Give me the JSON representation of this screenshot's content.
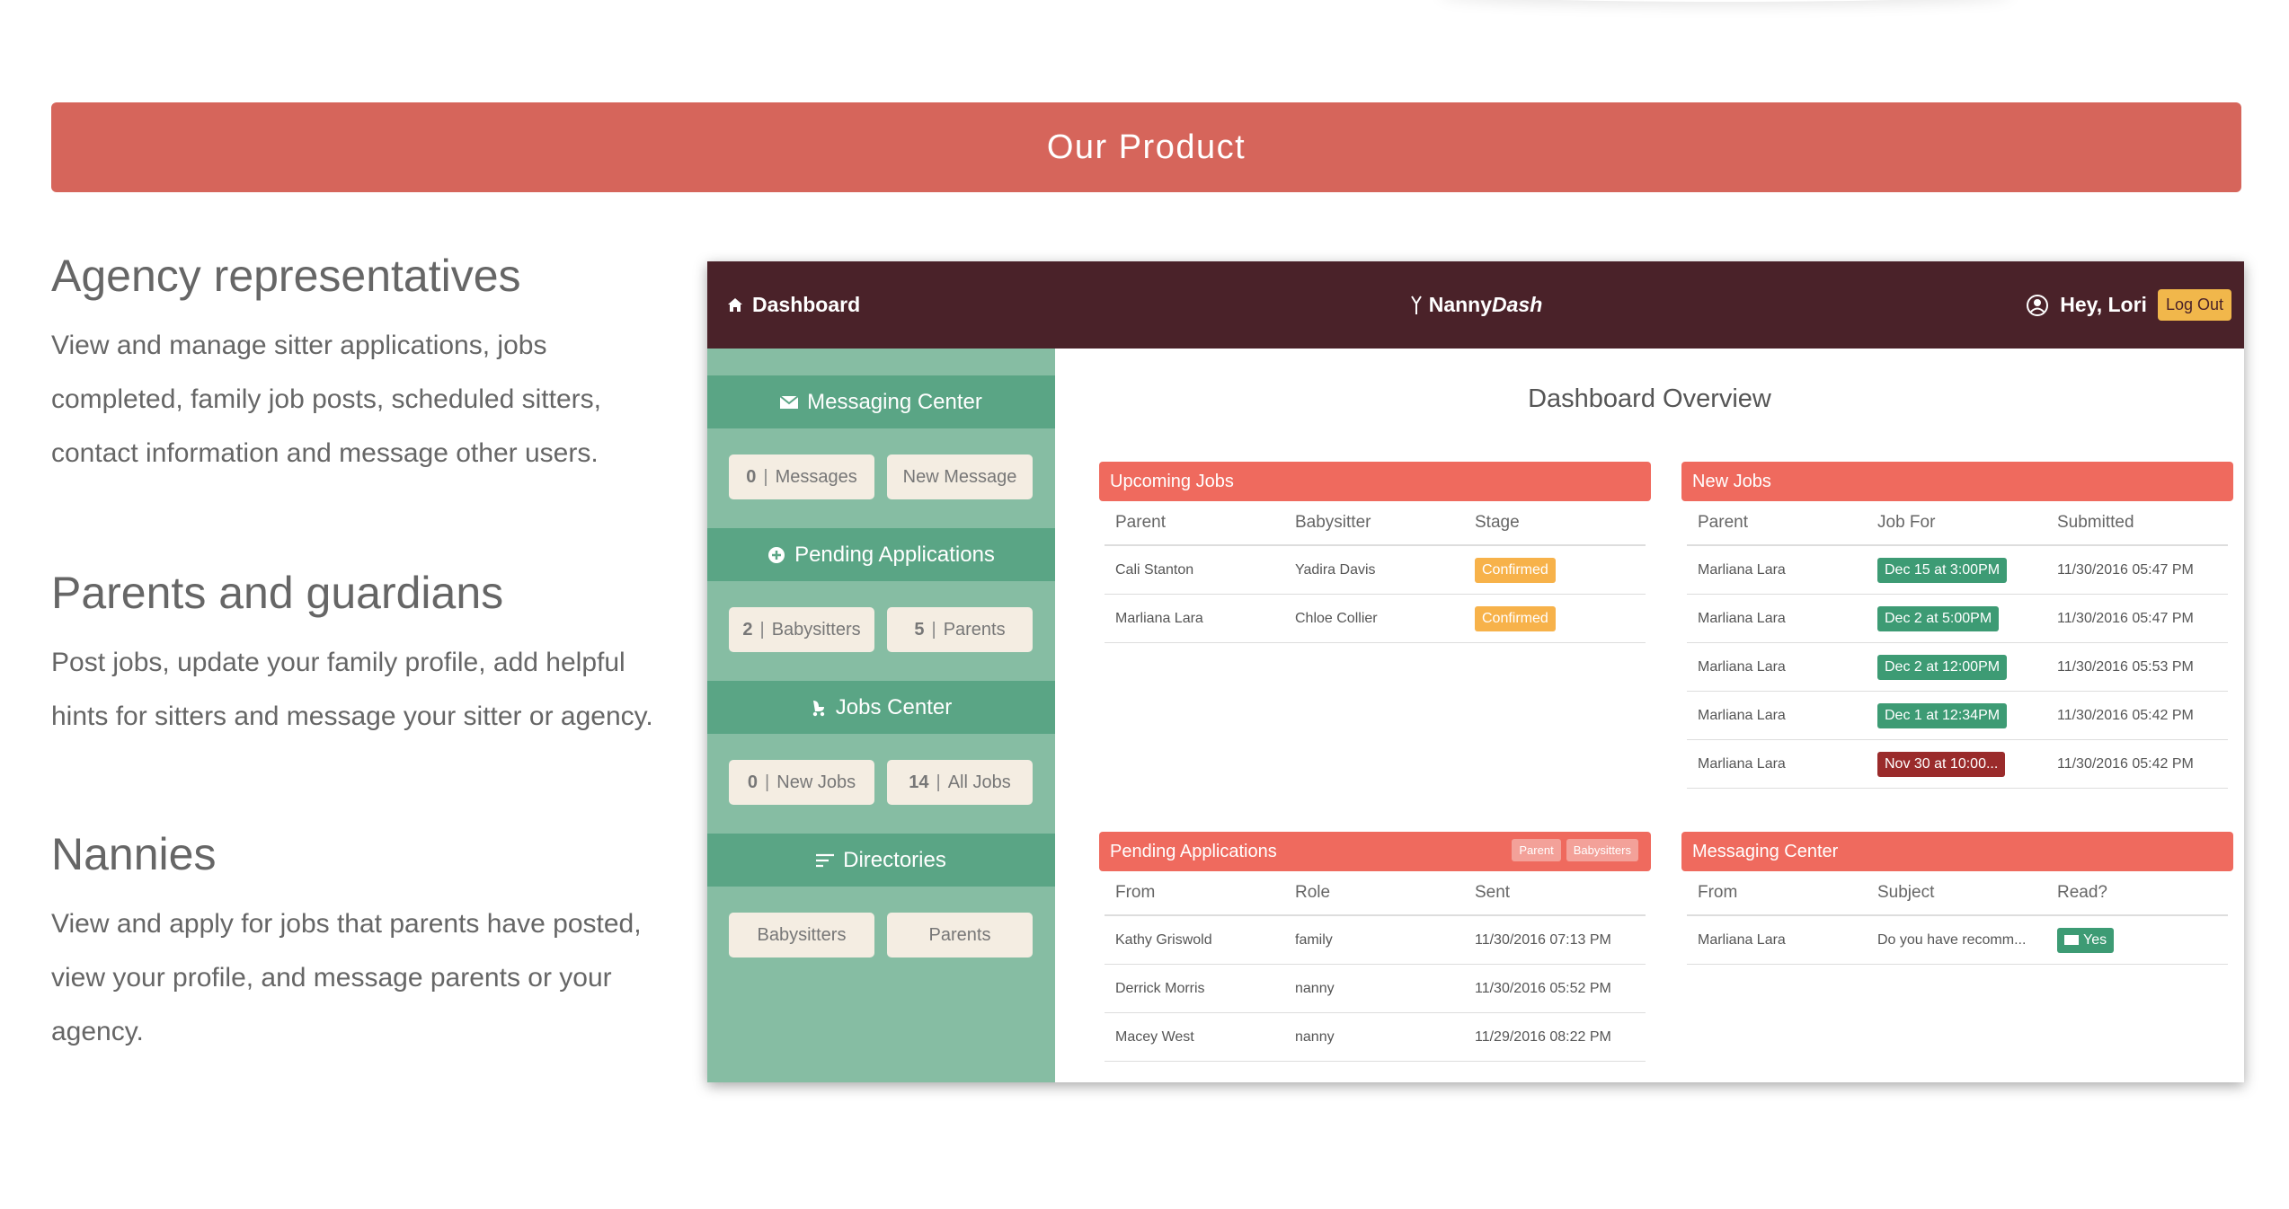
{
  "banner": {
    "title": "Our Product"
  },
  "sections": [
    {
      "heading": "Agency representatives",
      "text": "View and manage sitter applications, jobs completed, family job posts, scheduled sitters, contact information and message other users."
    },
    {
      "heading": "Parents and guardians",
      "text": "Post jobs, update your family profile, add helpful hints for sitters and message your sitter or agency."
    },
    {
      "heading": "Nannies",
      "text": "View and apply for jobs that parents have posted, view your profile, and message parents or your agency."
    }
  ],
  "dashboard": {
    "nav": {
      "home": "Dashboard",
      "brand_a": "Nanny",
      "brand_b": "Dash",
      "greeting": "Hey, Lori",
      "logout": "Log Out"
    },
    "sidebar": {
      "messaging": {
        "title": "Messaging Center",
        "count": "0",
        "count_label": "Messages",
        "new_label": "New Message"
      },
      "pending": {
        "title": "Pending Applications",
        "sitters_count": "2",
        "sitters_label": "Babysitters",
        "parents_count": "5",
        "parents_label": "Parents"
      },
      "jobs": {
        "title": "Jobs Center",
        "new_count": "0",
        "new_label": "New Jobs",
        "all_count": "14",
        "all_label": "All Jobs"
      },
      "directories": {
        "title": "Directories",
        "sitters": "Babysitters",
        "parents": "Parents"
      }
    },
    "overview_title": "Dashboard Overview",
    "upcoming": {
      "title": "Upcoming Jobs",
      "columns": [
        "Parent",
        "Babysitter",
        "Stage"
      ],
      "rows": [
        {
          "parent": "Cali Stanton",
          "sitter": "Yadira Davis",
          "stage": "Confirmed"
        },
        {
          "parent": "Marliana Lara",
          "sitter": "Chloe Collier",
          "stage": "Confirmed"
        }
      ]
    },
    "new_jobs": {
      "title": "New Jobs",
      "columns": [
        "Parent",
        "Job For",
        "Submitted"
      ],
      "rows": [
        {
          "parent": "Marliana Lara",
          "job": "Dec 15 at 3:00PM",
          "submitted": "11/30/2016 05:47 PM",
          "color": "#3d9b74"
        },
        {
          "parent": "Marliana Lara",
          "job": "Dec 2 at 5:00PM",
          "submitted": "11/30/2016 05:47 PM",
          "color": "#3d9b74"
        },
        {
          "parent": "Marliana Lara",
          "job": "Dec 2 at 12:00PM",
          "submitted": "11/30/2016 05:53 PM",
          "color": "#3d9b74"
        },
        {
          "parent": "Marliana Lara",
          "job": "Dec 1 at 12:34PM",
          "submitted": "11/30/2016 05:42 PM",
          "color": "#3d9b74"
        },
        {
          "parent": "Marliana Lara",
          "job": "Nov 30 at 10:00...",
          "submitted": "11/30/2016 05:42 PM",
          "color": "#9a2b2b"
        }
      ]
    },
    "pending_apps": {
      "title": "Pending Applications",
      "tags": [
        "Parent",
        "Babysitters"
      ],
      "columns": [
        "From",
        "Role",
        "Sent"
      ],
      "rows": [
        {
          "from": "Kathy Griswold",
          "role": "family",
          "sent": "11/30/2016 07:13 PM"
        },
        {
          "from": "Derrick Morris",
          "role": "nanny",
          "sent": "11/30/2016 05:52 PM"
        },
        {
          "from": "Macey West",
          "role": "nanny",
          "sent": "11/29/2016 08:22 PM"
        }
      ]
    },
    "messaging_panel": {
      "title": "Messaging Center",
      "columns": [
        "From",
        "Subject",
        "Read?"
      ],
      "rows": [
        {
          "from": "Marliana Lara",
          "subject": "Do you have recomm...",
          "read": "Yes"
        }
      ]
    }
  }
}
